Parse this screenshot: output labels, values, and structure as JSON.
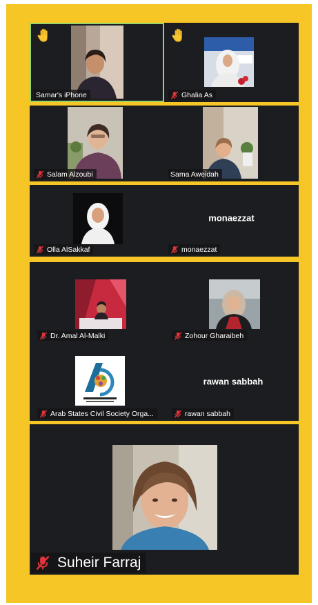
{
  "colors": {
    "frame": "#f6c627",
    "tile": "#1b1d20",
    "mute": "#e0343a",
    "active_border": "#9bd66b",
    "hand": "#f7c531"
  },
  "icons": {
    "mute": "microphone-muted-icon",
    "hand": "raised-hand-icon"
  },
  "participants": [
    {
      "name": "Samar's iPhone",
      "hand_raised": true,
      "muted": false,
      "active_speaker": true
    },
    {
      "name": "Ghalia As",
      "hand_raised": true,
      "muted": true
    },
    {
      "name": "Salam Alzoubi",
      "muted": true
    },
    {
      "name": "Sama Aweidah",
      "muted": false
    },
    {
      "name": "Olla AlSakkaf",
      "muted": true
    },
    {
      "name": "monaezzat",
      "muted": true,
      "display_text": "monaezzat"
    },
    {
      "name": "Dr. Amal Al-Malki",
      "muted": true
    },
    {
      "name": "Zohour Gharaibeh",
      "muted": true
    },
    {
      "name": "Arab States Civil Society Orga...",
      "muted": true
    },
    {
      "name": "rawan sabbah",
      "muted": true,
      "display_text": "rawan sabbah"
    },
    {
      "name": "Suheir Farraj",
      "muted": true
    }
  ]
}
